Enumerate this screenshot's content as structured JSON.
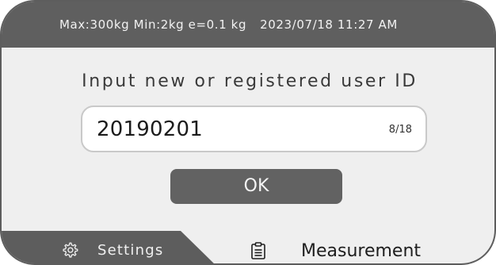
{
  "status_bar": {
    "specs": "Max:300kg Min:2kg e=0.1 kg",
    "datetime": "2023/07/18 11:27 AM"
  },
  "prompt": "Input new or registered user ID",
  "id_field": {
    "value": "20190201",
    "counter": "8/18"
  },
  "ok_label": "OK",
  "tabs": {
    "settings": {
      "label": "Settings",
      "icon": "gear-icon"
    },
    "measurement": {
      "label": "Measurement",
      "icon": "clipboard-icon"
    }
  },
  "colors": {
    "bar": "#5f5f5f",
    "panel": "#efefef",
    "button": "#626262",
    "field": "#ffffff"
  }
}
